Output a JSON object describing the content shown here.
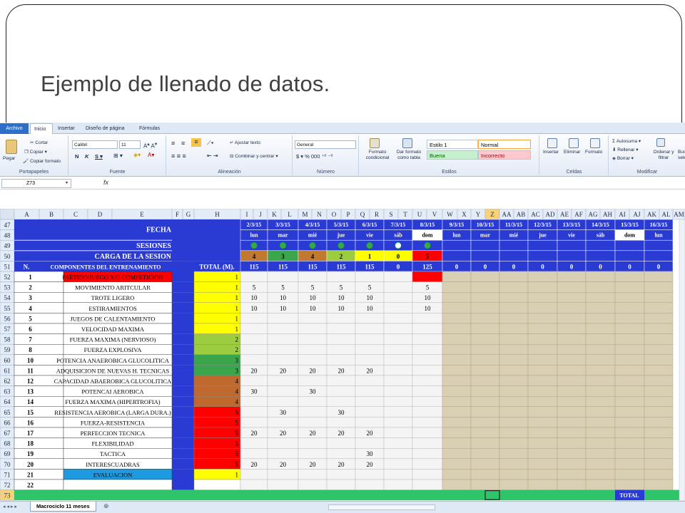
{
  "slide": {
    "title": "Ejemplo de llenado de datos."
  },
  "ribbon": {
    "tabs": [
      "Archivo",
      "Inicio",
      "Insertar",
      "Diseño de página",
      "Fórmulas"
    ],
    "active_tab": "Inicio",
    "clipboard": {
      "paste": "Pegar",
      "cut": "Cortar",
      "copy": "Copiar",
      "format_painter": "Copiar formato",
      "label": "Portapapeles"
    },
    "font": {
      "name": "Calibri",
      "size": "11",
      "label": "Fuente"
    },
    "alignment": {
      "wrap": "Ajustar texto",
      "merge": "Combinar y centrar",
      "label": "Alineación"
    },
    "number": {
      "format": "General",
      "label": "Número"
    },
    "styles": {
      "cond": "Formato condicional",
      "table": "Dar formato como tabla",
      "estilo1": "Estilo 1",
      "normal": "Normal",
      "buena": "Buena",
      "incorrecto": "Incorrecto",
      "label": "Estilos"
    },
    "cells": {
      "insert": "Insertar",
      "delete": "Eliminar",
      "format": "Formato",
      "label": "Celdas"
    },
    "editing": {
      "autosum": "Autosuma",
      "fill": "Rellenar",
      "clear": "Borrar",
      "sort": "Ordenar y filtrar",
      "find": "Buscar y seleccionar",
      "label": "Modificar"
    }
  },
  "formula_bar": {
    "cell_ref": "Z73",
    "fx": "fx"
  },
  "sheet": {
    "columns": [
      "A",
      "B",
      "C",
      "D",
      "E",
      "F",
      "G",
      "H",
      "I",
      "J",
      "K",
      "L",
      "M",
      "N",
      "O",
      "P",
      "Q",
      "R",
      "S",
      "T",
      "U",
      "V",
      "W",
      "X",
      "Y",
      "Z",
      "AA",
      "AB",
      "AC",
      "AD",
      "AE",
      "AF",
      "AG",
      "AH",
      "AI",
      "AJ",
      "AK",
      "AL",
      "AM"
    ],
    "selected_column": "Z",
    "header_rows": {
      "fecha": "FECHA",
      "sesiones": "SESIONES",
      "carga": "CARGA DE LA SESION",
      "n": "N.",
      "componentes": "COMPONENTES DEL ENTRENAMIENTO",
      "total": "TOTAL (M)."
    },
    "dates": [
      "2/3/15",
      "3/3/15",
      "4/3/15",
      "5/3/15",
      "6/3/15",
      "7/3/15",
      "8/3/15",
      "9/3/15",
      "10/3/15",
      "11/3/15",
      "12/3/15",
      "13/3/15",
      "14/3/15",
      "15/3/15",
      "16/3/15"
    ],
    "days": [
      "lun",
      "mar",
      "mié",
      "jue",
      "vie",
      "sáb",
      "dom",
      "lun",
      "mar",
      "mié",
      "jue",
      "vie",
      "sáb",
      "dom",
      "lun"
    ],
    "session_dots": [
      "green",
      "green",
      "green",
      "green",
      "green",
      "white",
      "green"
    ],
    "loads": [
      "4",
      "3",
      "4",
      "2",
      "1",
      "0",
      "5"
    ],
    "load_colors": [
      "#c0792e",
      "#3aa54a",
      "#c0792e",
      "#9ccc40",
      "#ffff00",
      "#ffff00",
      "#ff0000"
    ],
    "totals": [
      "115",
      "115",
      "115",
      "115",
      "115",
      "0",
      "125",
      "0",
      "0",
      "0",
      "0",
      "0",
      "0",
      "0",
      "0"
    ],
    "rows": [
      {
        "r": "52",
        "n": "1",
        "name": "PARTIDO/JUEGO Y/O COMPETICION",
        "h": "1",
        "hc": "#ffff00",
        "nc": "#ff0000",
        "v": [
          "",
          "",
          "",
          "",
          "",
          "",
          ""
        ]
      },
      {
        "r": "53",
        "n": "2",
        "name": "MOVIMIENTO ARITCULAR",
        "h": "1",
        "hc": "#ffff00",
        "v": [
          "5",
          "5",
          "5",
          "5",
          "5",
          "",
          "5"
        ]
      },
      {
        "r": "54",
        "n": "3",
        "name": "TROTE LIGERO",
        "h": "1",
        "hc": "#ffff00",
        "v": [
          "10",
          "10",
          "10",
          "10",
          "10",
          "",
          "10"
        ]
      },
      {
        "r": "55",
        "n": "4",
        "name": "ESTIRAMIENTOS",
        "h": "1",
        "hc": "#ffff00",
        "v": [
          "10",
          "10",
          "10",
          "10",
          "10",
          "",
          "10"
        ]
      },
      {
        "r": "56",
        "n": "5",
        "name": "JUEGOS DE CALENTAMIENTO",
        "h": "1",
        "hc": "#ffff00",
        "v": [
          "",
          "",
          "",
          "",
          "",
          "",
          ""
        ]
      },
      {
        "r": "57",
        "n": "6",
        "name": "VELOCIDAD MAXIMA",
        "h": "1",
        "hc": "#ffff00",
        "v": [
          "",
          "",
          "",
          "",
          "",
          "",
          ""
        ]
      },
      {
        "r": "58",
        "n": "7",
        "name": "FUERZA MAXIMA (NERVIOSO)",
        "h": "2",
        "hc": "#9ccc40",
        "v": [
          "",
          "",
          "",
          "",
          "",
          "",
          ""
        ]
      },
      {
        "r": "59",
        "n": "8",
        "name": "FUERZA EXPLOSIVA",
        "h": "2",
        "hc": "#9ccc40",
        "v": [
          "",
          "",
          "",
          "",
          "",
          "",
          ""
        ]
      },
      {
        "r": "60",
        "n": "10",
        "name": "POTENCIA ANAEROBICA GLUCOLITICA",
        "h": "3",
        "hc": "#3aa54a",
        "v": [
          "",
          "",
          "",
          "",
          "",
          "",
          ""
        ]
      },
      {
        "r": "61",
        "n": "11",
        "name": "ADQUISICION DE NUEVAS H. TECNICAS",
        "h": "3",
        "hc": "#3aa54a",
        "v": [
          "20",
          "20",
          "20",
          "20",
          "20",
          "",
          ""
        ]
      },
      {
        "r": "62",
        "n": "12",
        "name": "CAPACIDAD ABAEROBICA GLUCOLITICA",
        "h": "4",
        "hc": "#c0692e",
        "v": [
          "",
          "",
          "",
          "",
          "",
          "",
          ""
        ]
      },
      {
        "r": "63",
        "n": "13",
        "name": "POTENCAI AEROBICA",
        "h": "4",
        "hc": "#c0692e",
        "v": [
          "30",
          "",
          "30",
          "",
          "",
          "",
          ""
        ]
      },
      {
        "r": "64",
        "n": "14",
        "name": "FUERZA MAXIMA (HIPERTROFIA)",
        "h": "4",
        "hc": "#c0692e",
        "v": [
          "",
          "",
          "",
          "",
          "",
          "",
          ""
        ]
      },
      {
        "r": "65",
        "n": "15",
        "name": "RESISTENCIA AEROBICA (LARGA DURA.)",
        "h": "5",
        "hc": "#ff0000",
        "v": [
          "",
          "30",
          "",
          "30",
          "",
          "",
          ""
        ]
      },
      {
        "r": "66",
        "n": "16",
        "name": "FUERZA-RESISTENCIA",
        "h": "5",
        "hc": "#ff0000",
        "v": [
          "",
          "",
          "",
          "",
          "",
          "",
          ""
        ]
      },
      {
        "r": "67",
        "n": "17",
        "name": "PERFECCION TECNICA",
        "h": "5",
        "hc": "#ff0000",
        "v": [
          "20",
          "20",
          "20",
          "20",
          "20",
          "",
          ""
        ]
      },
      {
        "r": "68",
        "n": "18",
        "name": "FLEXIBILIDAD",
        "h": "5",
        "hc": "#ff0000",
        "v": [
          "",
          "",
          "",
          "",
          "",
          "",
          ""
        ]
      },
      {
        "r": "69",
        "n": "19",
        "name": "TACTICA",
        "h": "5",
        "hc": "#ff0000",
        "v": [
          "",
          "",
          "",
          "",
          "30",
          "",
          ""
        ]
      },
      {
        "r": "70",
        "n": "20",
        "name": "INTERESCUADRAS",
        "h": "5",
        "hc": "#ff0000",
        "v": [
          "20",
          "20",
          "20",
          "20",
          "20",
          "",
          ""
        ]
      },
      {
        "r": "71",
        "n": "21",
        "name": "EVALUACION",
        "h": "1",
        "hc": "#ffff00",
        "nc": "#1e9be0",
        "v": [
          "",
          "",
          "",
          "",
          "",
          "",
          ""
        ]
      },
      {
        "r": "72",
        "n": "22",
        "name": "",
        "h": "",
        "hc": "#ffffff",
        "v": [
          "",
          "",
          "",
          "",
          "",
          "",
          ""
        ]
      }
    ],
    "last_row": {
      "r": "73",
      "label": "TOTAL"
    },
    "tab": "Macrociclo 11 meses"
  }
}
